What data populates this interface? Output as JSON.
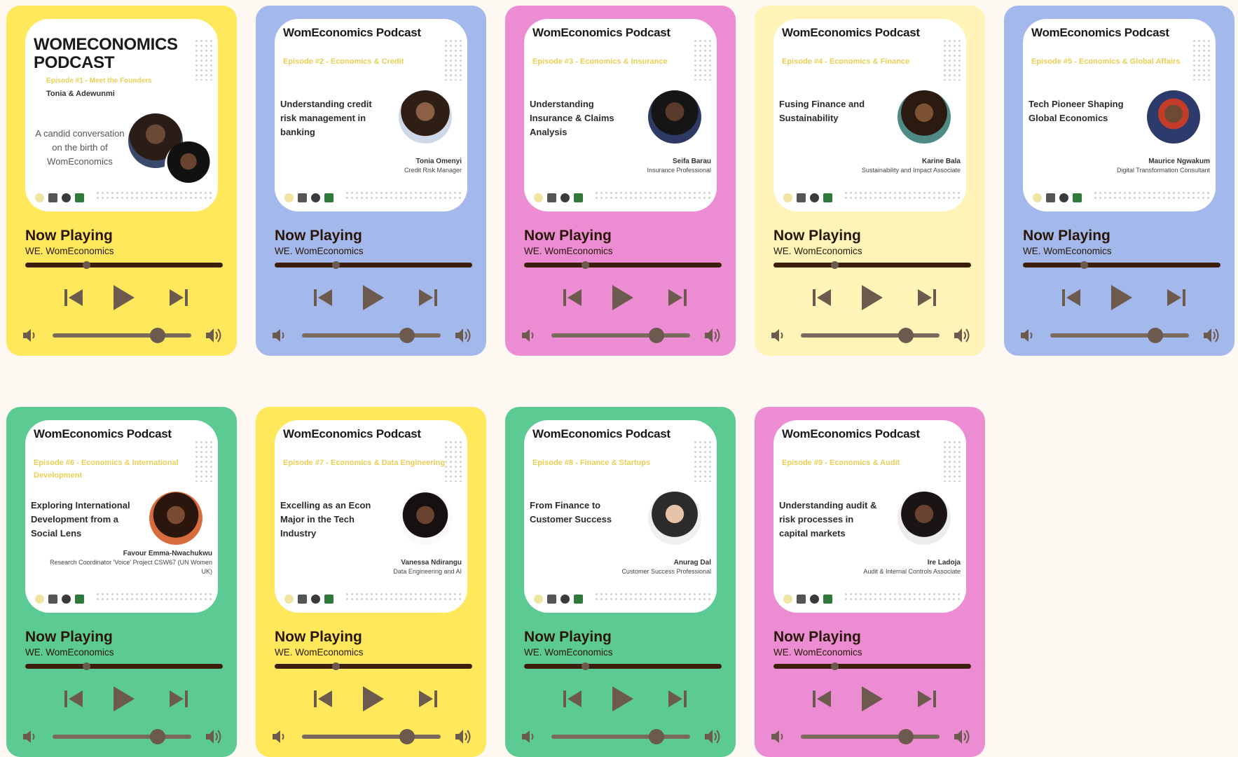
{
  "player": {
    "now_playing_label": "Now Playing",
    "artist": "WE. WomEconomics",
    "progress_fraction": 0.31,
    "volume_fraction": 0.76
  },
  "icons": {
    "prev": "skip-previous-icon",
    "play": "play-icon",
    "next": "skip-next-icon",
    "vol_low": "volume-low-icon",
    "vol_high": "volume-high-icon"
  },
  "cards": [
    {
      "bg": "#ffe85c",
      "title": "WOMECONOMICS PODCAST",
      "episode": "Episode #1 - Meet the Founders",
      "subtitle": "Tonia & Adewunmi",
      "topic": "A candid conversation on the birth of WomEconomics",
      "guest": "",
      "role": ""
    },
    {
      "bg": "#a3b8eb",
      "title": "WomEconomics Podcast",
      "episode": "Episode #2 - Economics & Credit",
      "subtitle": "",
      "topic": "Understanding credit risk management in banking",
      "guest": "Tonia Omenyi",
      "role": "Credit Risk Manager"
    },
    {
      "bg": "#ec8dd4",
      "title": "WomEconomics Podcast",
      "episode": "Episode #3 - Economics & Insurance",
      "subtitle": "",
      "topic": "Understanding Insurance & Claims Analysis",
      "guest": "Seifa Barau",
      "role": "Insurance Professional"
    },
    {
      "bg": "#fff3b8",
      "title": "WomEconomics Podcast",
      "episode": "Episode #4 - Economics & Finance",
      "subtitle": "",
      "topic": "Fusing Finance and Sustainability",
      "guest": "Karine Bala",
      "role": "Sustainability and Impact Associate"
    },
    {
      "bg": "#a3b8eb",
      "title": "WomEconomics Podcast",
      "episode": "Episode #5 - Economics & Global Affairs",
      "subtitle": "",
      "topic": "Tech Pioneer Shaping Global Economics",
      "guest": "Maurice Ngwakum",
      "role": "Digital Transformation Consultant"
    },
    {
      "bg": "#5ccb93",
      "title": "WomEconomics Podcast",
      "episode": "Episode #6 - Economics & International Development",
      "subtitle": "",
      "topic": "Exploring International Development from a Social Lens",
      "guest": "Favour Emma-Nwachukwu",
      "role": "Research Coordinator 'Voice' Project CSW67 (UN Women UK)"
    },
    {
      "bg": "#ffe85c",
      "title": "WomEconomics Podcast",
      "episode": "Episode #7 - Economics & Data Engineering",
      "subtitle": "",
      "topic": "Excelling as an Econ Major in the Tech Industry",
      "guest": "Vanessa Ndirangu",
      "role": "Data Engineering and AI"
    },
    {
      "bg": "#5ccb93",
      "title": "WomEconomics Podcast",
      "episode": "Episode #8 - Finance & Startups",
      "subtitle": "",
      "topic": "From Finance to Customer Success",
      "guest": "Anurag Dal",
      "role": "Customer Success Professional"
    },
    {
      "bg": "#ec8dd4",
      "title": "WomEconomics Podcast",
      "episode": "Episode #9 - Economics & Audit",
      "subtitle": "",
      "topic": "Understanding audit & risk processes in capital markets",
      "guest": "Ire Ladoja",
      "role": "Audit & Internal Controls Associate"
    }
  ]
}
